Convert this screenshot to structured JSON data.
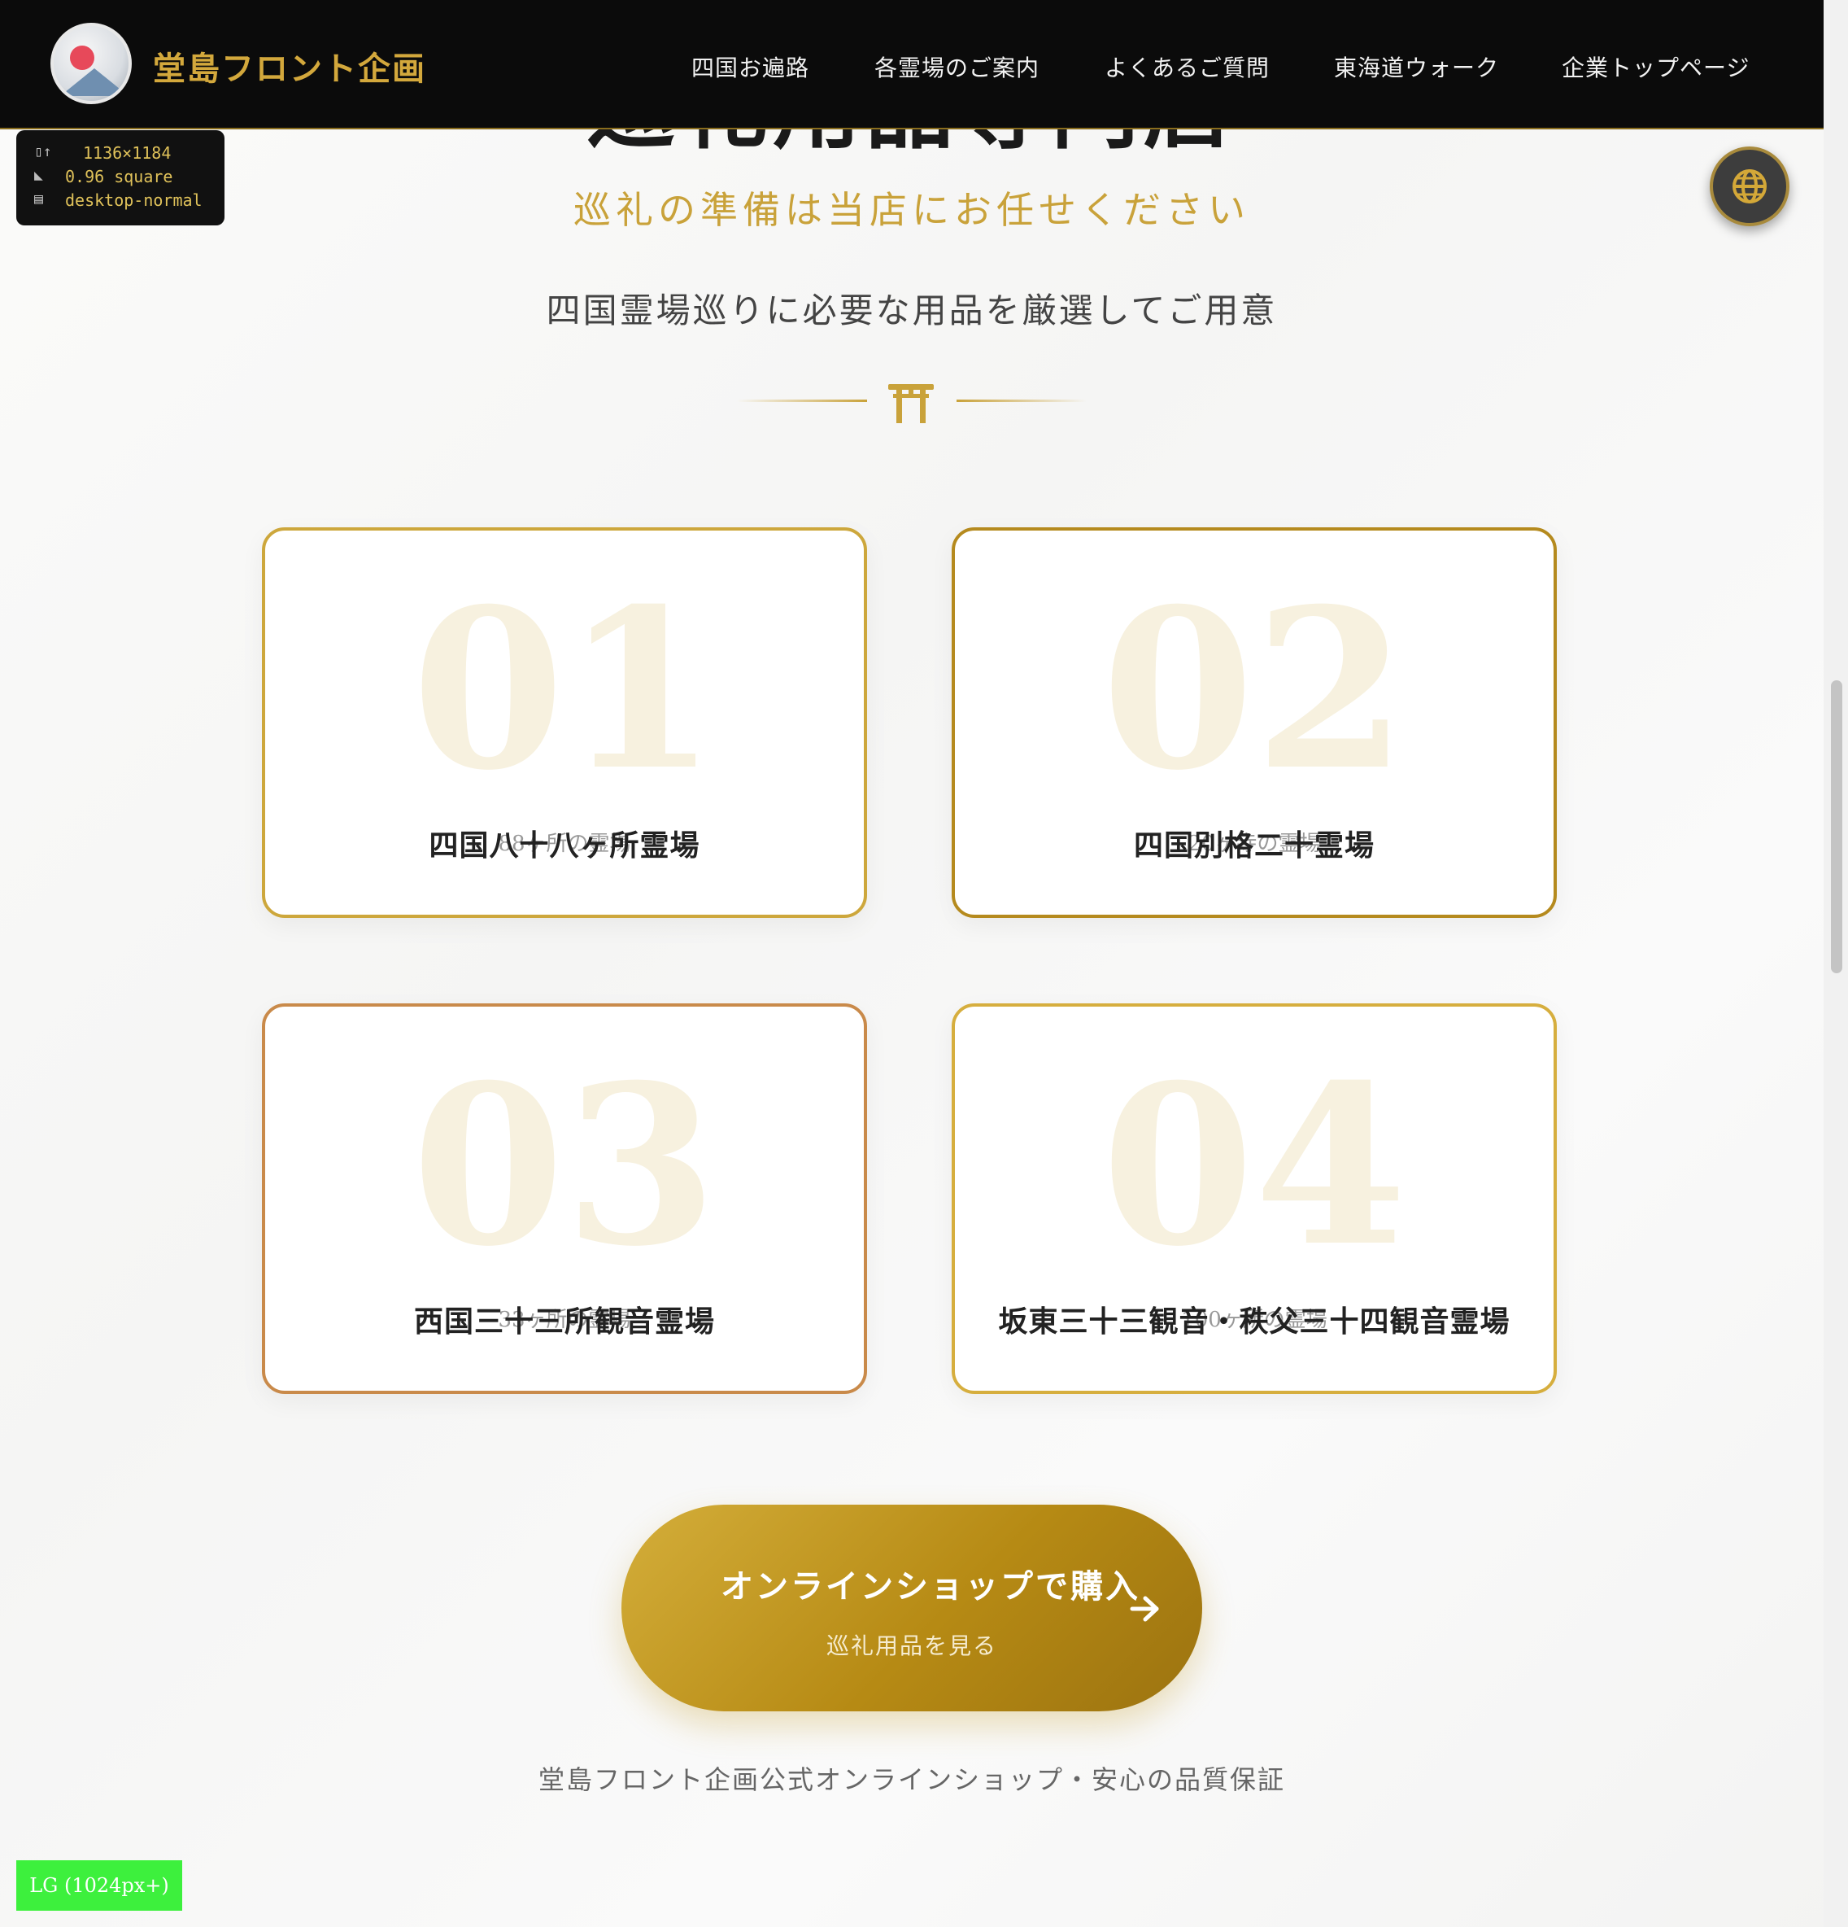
{
  "header": {
    "brand": "堂島フロント企画",
    "nav": [
      "四国お遍路",
      "各霊場のご案内",
      "よくあるご質問",
      "東海道ウォーク",
      "企業トップページ"
    ]
  },
  "page": {
    "title": "巡礼用品専門店",
    "subtitle": "巡礼の準備は当店にお任せください",
    "description": "四国霊場巡りに必要な用品を厳選してご用意"
  },
  "viewport_info": {
    "size": "1136×1184",
    "ratio": "0.96 square",
    "mode": "desktop-normal"
  },
  "cards": [
    {
      "num": "01",
      "title": "四国八十八ヶ所霊場",
      "sub": "88ヶ所の霊場",
      "border": "#cda73c"
    },
    {
      "num": "02",
      "title": "四国別格二十霊場",
      "sub": "20ヶ寺の霊場",
      "border": "#b58a1e"
    },
    {
      "num": "03",
      "title": "西国三十三所観音霊場",
      "sub": "33ヶ所の霊場",
      "border": "#c98a4a"
    },
    {
      "num": "04",
      "title": "坂東三十三観音・秩父三十四観音霊場",
      "sub": "100ヶ所の霊場",
      "border": "#d6ae3e"
    }
  ],
  "cta": {
    "main": "オンラインショップで購入",
    "sub": "巡礼用品を見る"
  },
  "footnote": "堂島フロント企画公式オンラインショップ・安心の品質保証",
  "breakpoint": "LG (1024px+)",
  "colors": {
    "gold": "#c9a23a",
    "header_bg": "#0b0b0b"
  }
}
